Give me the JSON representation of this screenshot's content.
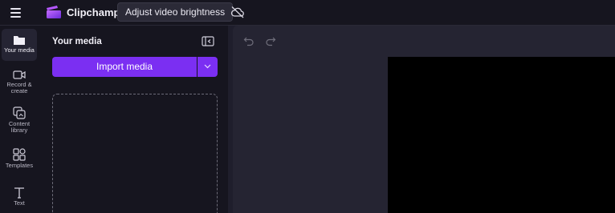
{
  "topbar": {
    "app_name": "Clipchamp",
    "tooltip": "Adjust video brightness"
  },
  "rail": {
    "items": [
      {
        "label_1": "Your media",
        "label_2": "",
        "icon": "folder-icon",
        "active": true
      },
      {
        "label_1": "Record &",
        "label_2": "create",
        "icon": "video-camera-icon",
        "active": false
      },
      {
        "label_1": "Content",
        "label_2": "library",
        "icon": "content-library-icon",
        "active": false
      },
      {
        "label_1": "Templates",
        "label_2": "",
        "icon": "templates-icon",
        "active": false
      },
      {
        "label_1": "Text",
        "label_2": "",
        "icon": "text-icon",
        "active": false
      }
    ]
  },
  "panel": {
    "title": "Your media",
    "import_label": "Import media"
  },
  "colors": {
    "accent": "#7b2ff2",
    "background": "#16151f",
    "editor_bg": "#252432",
    "preview_bg": "#000000"
  }
}
